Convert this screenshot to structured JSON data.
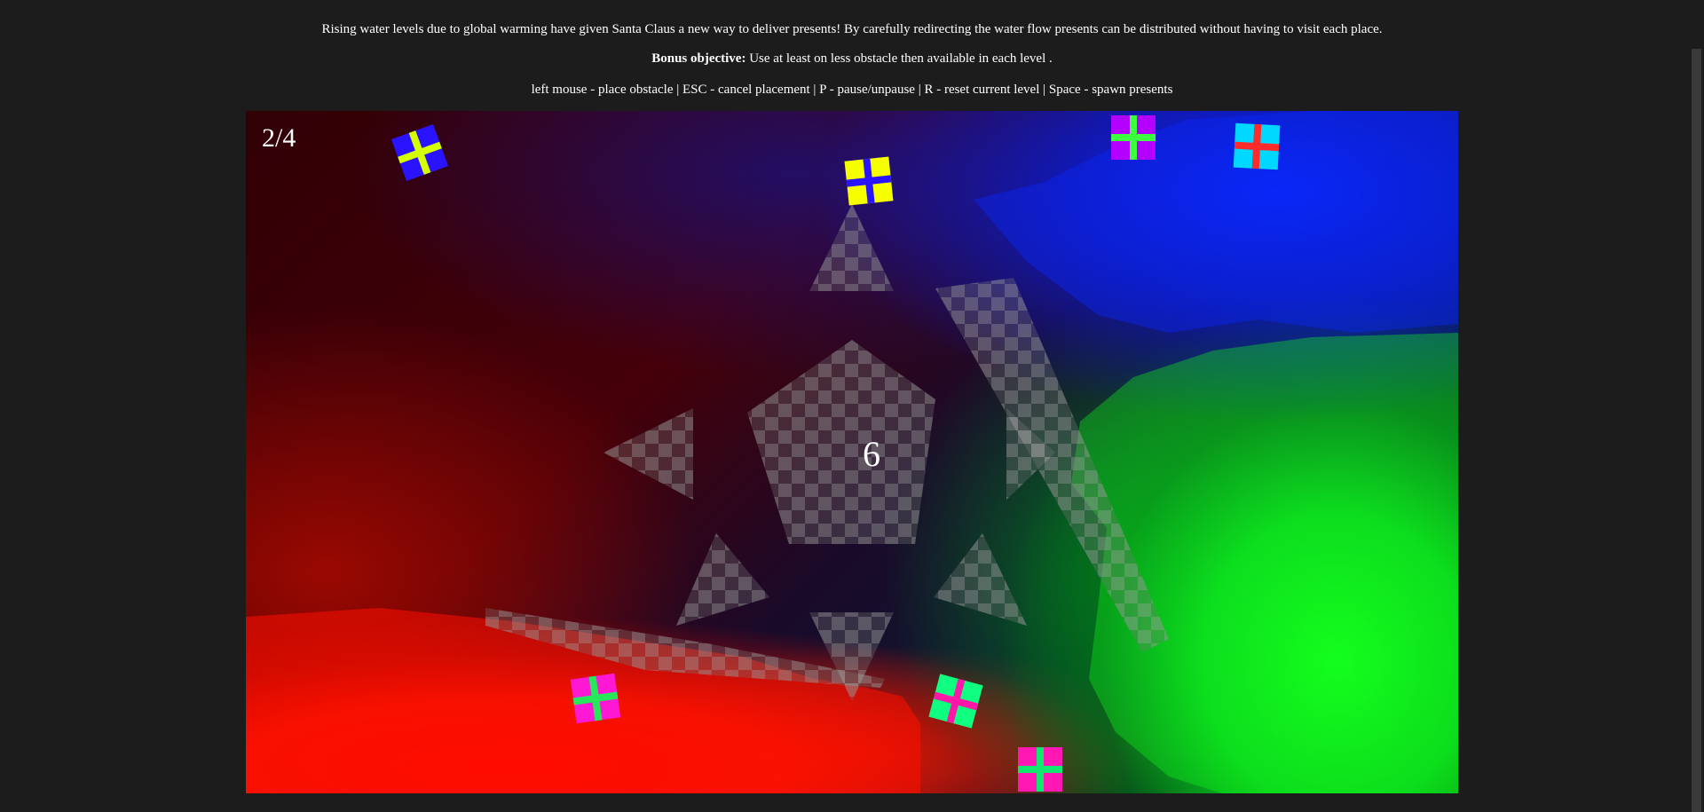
{
  "intro": {
    "description": "Rising water levels due to global warming have given Santa Claus a new way to deliver presents! By carefully redirecting the water flow presents can be distributed without having to visit each place.",
    "bonus_label": "Bonus objective:",
    "bonus_text": " Use at least on less obstacle then available in each level .",
    "controls": "left mouse - place obstacle | ESC - cancel placement | P - pause/unpause | R - reset current level | Space - spawn presents"
  },
  "game": {
    "level": "2/4",
    "obstacles_available": "6",
    "fluid_colors": {
      "red": "#ff1400",
      "green": "#14ff1e",
      "blue": "#0a28ff"
    },
    "presents": [
      {
        "box": "#2a14ff",
        "ribbon": "#d6ff00"
      },
      {
        "box": "#f5ff00",
        "ribbon": "#2a14ff"
      },
      {
        "box": "#b400ff",
        "ribbon": "#3cff40"
      },
      {
        "box": "#00d8ff",
        "ribbon": "#ff2a2a"
      },
      {
        "box": "#ff18d4",
        "ribbon": "#26e85a"
      },
      {
        "box": "#10ff80",
        "ribbon": "#ff18a8"
      },
      {
        "box": "#ff18b4",
        "ribbon": "#10e870"
      }
    ]
  }
}
